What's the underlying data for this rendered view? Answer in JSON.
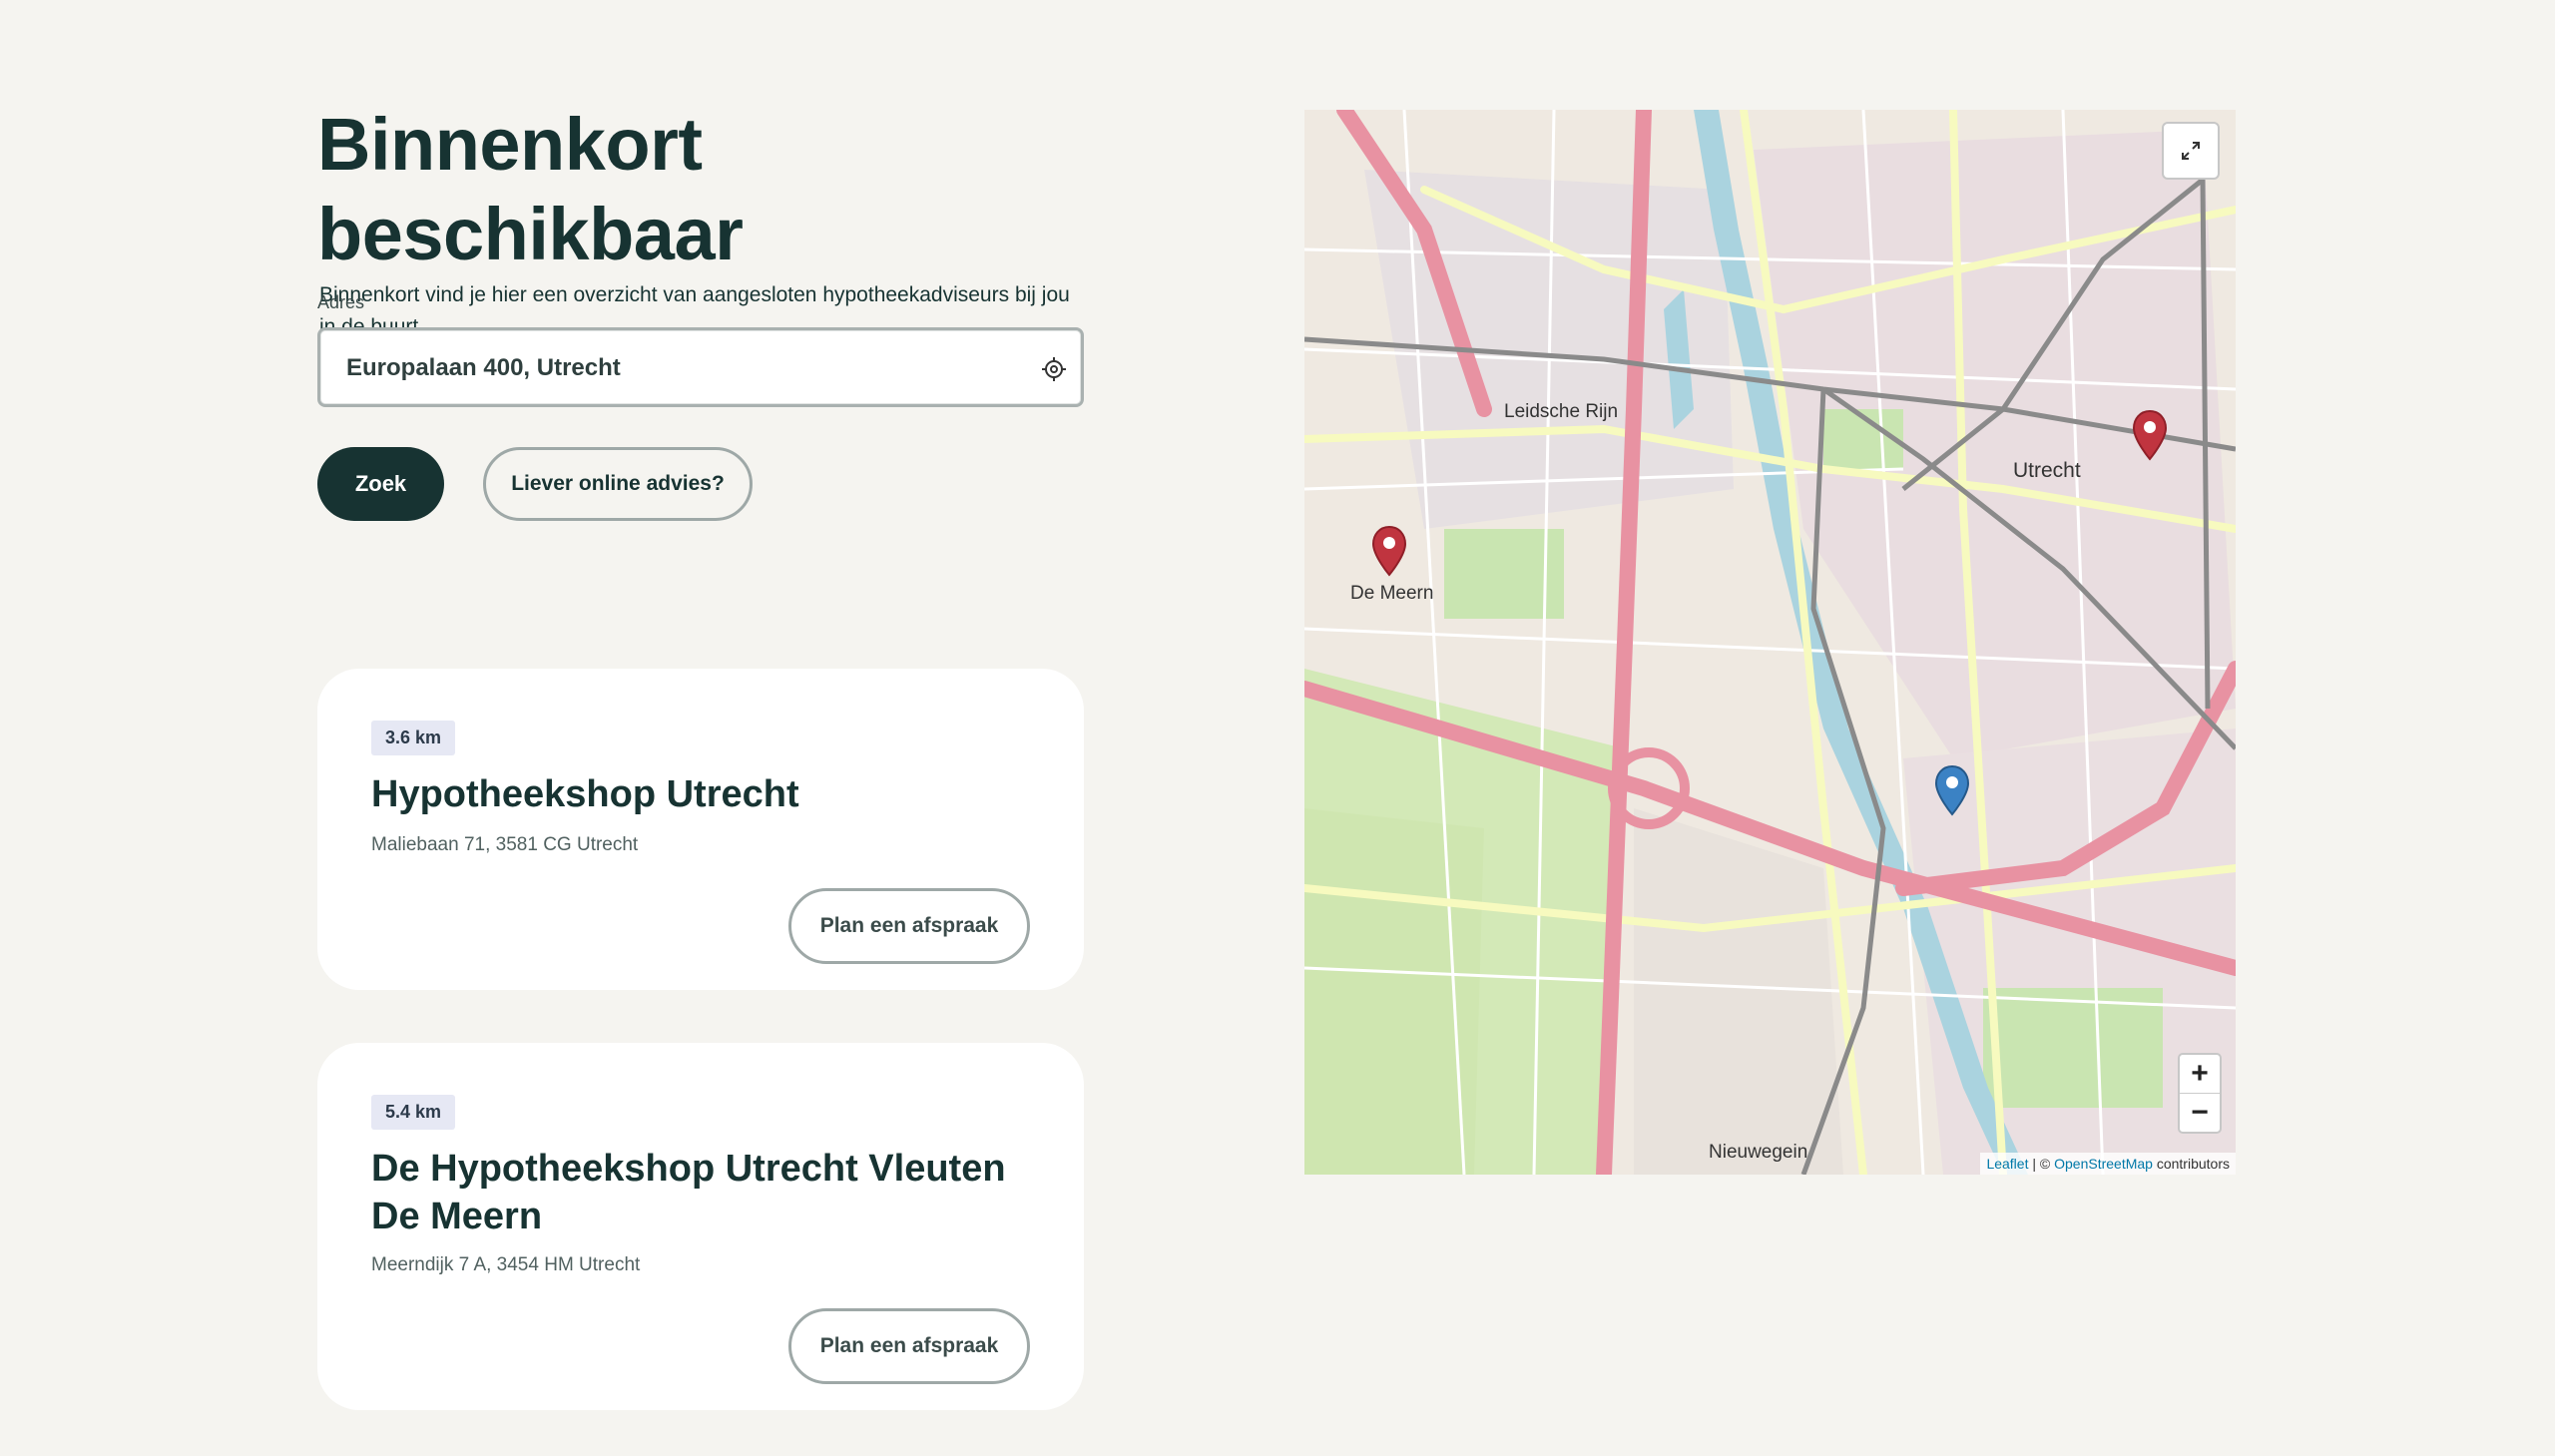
{
  "header": {
    "title": "Binnenkort beschikbaar",
    "intro": "Binnenkort vind je hier een overzicht van aangesloten hypotheekadviseurs bij jou in de buurt."
  },
  "search": {
    "label": "Adres",
    "value": "Europalaan 400, Utrecht",
    "submit_label": "Zoek",
    "online_label": "Liever online advies?"
  },
  "results": [
    {
      "distance": "3.6 km",
      "name": "Hypotheekshop Utrecht",
      "address": "Maliebaan 71, 3581 CG Utrecht",
      "cta": "Plan een afspraak"
    },
    {
      "distance": "5.4 km",
      "name": "De Hypotheekshop Utrecht Vleuten De Meern",
      "address": "Meerndijk 7 A, 3454 HM Utrecht",
      "cta": "Plan een afspraak"
    }
  ],
  "map": {
    "labels": {
      "utrecht": "Utrecht",
      "de_meern": "De Meern",
      "leidsche_rijn": "Leidsche Rijn",
      "nieuwegein": "Nieuwegein"
    },
    "zoom_in": "+",
    "zoom_out": "−",
    "attribution": {
      "leaflet": "Leaflet",
      "separator": "| ©",
      "osm": "OpenStreetMap",
      "suffix": "contributors"
    },
    "marker_colors": {
      "office": "#c0343f",
      "search": "#3b82c4"
    }
  },
  "colors": {
    "primary": "#173332",
    "background": "#f5f4f0",
    "badge": "#e6e8f4"
  }
}
